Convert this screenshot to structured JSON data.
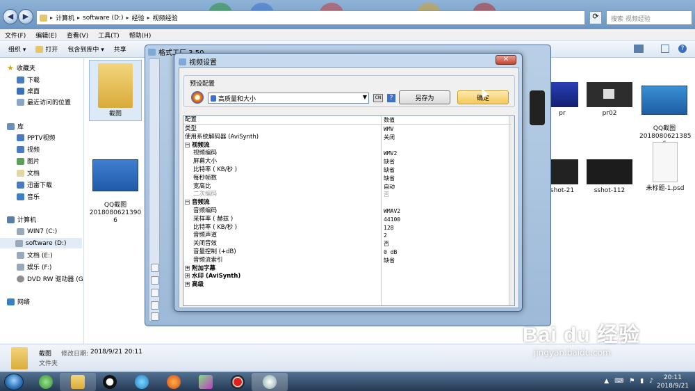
{
  "explorer": {
    "address": [
      "计算机",
      "software (D:)",
      "经验",
      "视频经验"
    ],
    "search_placeholder": "搜索 视频经验",
    "menu": [
      "文件(F)",
      "编辑(E)",
      "查看(V)",
      "工具(T)",
      "帮助(H)"
    ],
    "commands": [
      "组织 ▾",
      "打开",
      "包含到库中 ▾",
      "共享"
    ],
    "nav": {
      "favorites_label": "收藏夹",
      "favorites": [
        "下载",
        "桌面",
        "最近访问的位置"
      ],
      "library_label": "库",
      "libraries": [
        "PPTV视频",
        "视频",
        "图片",
        "文档",
        "迅雷下载",
        "音乐"
      ],
      "computer_label": "计算机",
      "drives": [
        "WIN7 (C:)",
        "software (D:)",
        "文档 (E:)",
        "娱乐 (F:)",
        "DVD RW 驱动器 (G"
      ],
      "network_label": "网络"
    },
    "files_left": [
      {
        "name": "截图"
      },
      {
        "name": "QQ截图\n2018080621390\n6"
      }
    ],
    "files_right": [
      {
        "name": "pr"
      },
      {
        "name": "pr02"
      },
      {
        "name": "QQ截图\n2018080621385\n6"
      },
      {
        "name": "shot-21"
      },
      {
        "name": "sshot-112"
      },
      {
        "name": "未标题-1.psd"
      }
    ],
    "details": {
      "name": "截图",
      "modified_label": "修改日期:",
      "modified": "2018/9/21 20:11",
      "type": "文件夹"
    },
    "back_window_title": "格式工厂 3.50"
  },
  "taskbar": {
    "time": "20:11",
    "date": "2018/9/21"
  },
  "dialog": {
    "title": "视频设置",
    "close_glyph": "✕",
    "preset_group_label": "预设配置",
    "preset_value": "高质量和大小",
    "save_as_label": "另存为",
    "ok_label": "确定",
    "help_label": "?",
    "grid": {
      "col_config": "配置",
      "col_value": "数值",
      "rows": [
        {
          "label": "类型",
          "value": "WMV",
          "kind": "plain",
          "indent": 0
        },
        {
          "label": "使用系统解码器 (AviSynth)",
          "value": "关闭",
          "kind": "plain",
          "indent": 0
        },
        {
          "label": "视频流",
          "value": "",
          "kind": "section",
          "indent": 0,
          "toggle": "−"
        },
        {
          "label": "视频编码",
          "value": "WMV2",
          "kind": "plain",
          "indent": 1
        },
        {
          "label": "屏幕大小",
          "value": "缺省",
          "kind": "plain",
          "indent": 1
        },
        {
          "label": "比特率 ( KB/秒 )",
          "value": "缺省",
          "kind": "plain",
          "indent": 1
        },
        {
          "label": "每秒帧数",
          "value": "缺省",
          "kind": "plain",
          "indent": 1
        },
        {
          "label": "宽高比",
          "value": "自动",
          "kind": "plain",
          "indent": 1
        },
        {
          "label": "二次编码",
          "value": "否",
          "kind": "disabled",
          "indent": 1
        },
        {
          "label": "音频流",
          "value": "",
          "kind": "section",
          "indent": 0,
          "toggle": "−"
        },
        {
          "label": "音频编码",
          "value": "WMAV2",
          "kind": "plain",
          "indent": 1
        },
        {
          "label": "采样率 ( 赫兹 )",
          "value": "44100",
          "kind": "plain",
          "indent": 1
        },
        {
          "label": "比特率 ( KB/秒 )",
          "value": "128",
          "kind": "plain",
          "indent": 1
        },
        {
          "label": "音频声道",
          "value": "2",
          "kind": "plain",
          "indent": 1
        },
        {
          "label": "关闭音效",
          "value": "否",
          "kind": "plain",
          "indent": 1
        },
        {
          "label": "音量控制 (+dB)",
          "value": "0 dB",
          "kind": "plain",
          "indent": 1
        },
        {
          "label": "音频流索引",
          "value": "缺省",
          "kind": "plain",
          "indent": 1
        },
        {
          "label": "附加字幕",
          "value": "",
          "kind": "section",
          "indent": 0,
          "toggle": "+"
        },
        {
          "label": "水印 (AviSynth)",
          "value": "",
          "kind": "section",
          "indent": 0,
          "toggle": "+"
        },
        {
          "label": "高级",
          "value": "",
          "kind": "section",
          "indent": 0,
          "toggle": "+"
        }
      ]
    }
  },
  "watermark": {
    "brand": "Bai du 经验",
    "url": "jingyan.baidu.com"
  },
  "colors": {
    "accent": "#f6c957",
    "title_blue": "#6b95c2"
  }
}
